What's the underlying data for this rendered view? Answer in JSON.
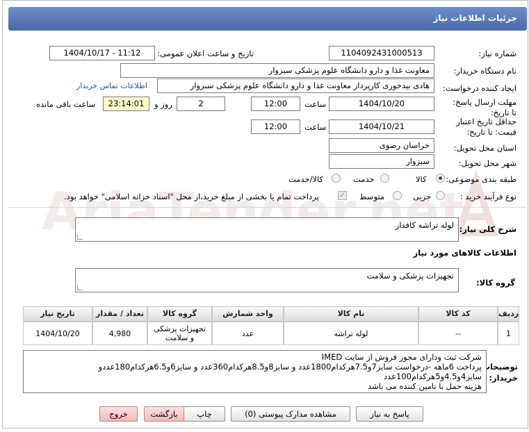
{
  "header": {
    "title": "جزئیات اطلاعات نیاز"
  },
  "form": {
    "need_number_label": "شماره نیاز:",
    "need_number": "1104092431000513",
    "announce_label": "تاریخ و ساعت اعلان عمومی:",
    "announce_value": "1404/10/17 - 11:12",
    "buyer_org_label": "نام دستگاه خریدار:",
    "buyer_org": "معاونت غذا و دارو   دانشگاه علوم پزشکی سبزوار",
    "creator_label": "ایجاد کننده درخواست:",
    "creator": "هادی بیدخوری کارپرداز معاونت غذا و دارو   دانشگاه علوم پزشکی سبزوار",
    "contact_link": "اطلاعات تماس خریدار",
    "deadline_label": "مهلت ارسال پاسخ: تا تاریخ:",
    "deadline_date": "1404/10/20",
    "time_label": "ساعت",
    "deadline_time": "12:00",
    "days_value": "2",
    "days_label": "روز و",
    "remaining_time": "23:14:01",
    "remaining_label": "ساعت باقی مانده",
    "validity_label_1": "حداقل تاریخ اعتبار",
    "validity_label_2": "قیمت: تا تاریخ:",
    "validity_date": "1404/10/21",
    "validity_time": "12:00",
    "province_label": "استان محل تحویل:",
    "province": "خراسان رضوی",
    "city_label": "شهر محل تحویل:",
    "city": "سبزوار",
    "category_label": "طبقه بندی موضوعی:",
    "category_options": [
      "کالا",
      "خدمت",
      "کالا/خدمت"
    ],
    "process_label": "نوع فرآیند خرید :",
    "process_options": [
      "جزیی",
      "متوسط"
    ],
    "payment_note": "پرداخت تمام یا بخشی از مبلغ خرید،از محل \"اسناد خزانه اسلامی\" خواهد بود.",
    "general_desc_label": "شرح کلی نیاز:",
    "general_desc": "لوله تراشه کافدار",
    "goods_info_title": "اطلاعات کالاهای مورد نیاز",
    "goods_group_label": "گروه کالا:",
    "goods_group": "تجهیزات پزشکی و سلامت",
    "buyer_notes_label_1": "توضیحات",
    "buyer_notes_label_2": "خریدار:",
    "buyer_notes": [
      "شرکت ثبت ودارای مجوز فروش از سایت IMED",
      "پرداخت 6ماهه -درخواست سایز7و7.5هرکدام1800عدد و سایز8و8.5هرکدام360عدد و سایز6و6.5هرکدام180عددو",
      "سایز4و4.5و5هرکدام100عدد",
      "هزینه حمل با تامین کننده می باشد"
    ]
  },
  "table": {
    "headers": [
      "ردیف",
      "کد کالا",
      "نام کالا",
      "واحد شمارش",
      "گروه کالا",
      "تعداد / مقدار",
      "تاریخ نیاز"
    ],
    "rows": [
      [
        "1",
        "--",
        "لوله تراشه",
        "عدد",
        "تجهیزات پزشکی و سلامت",
        "4,980",
        "1404/10/20"
      ]
    ]
  },
  "buttons": {
    "reply": "پاسخ به نیاز",
    "docs": "مشاهده مدارک پیوستی (0)",
    "print": "چاپ",
    "back": "بازگشت",
    "exit": "خروج"
  },
  "watermark": "AriaTender.net",
  "colors": {
    "title_bar": "#5a7bbd",
    "link": "#1a4fd6",
    "remaining_bg": "#ffffcc",
    "watermark": "#e6c9c9"
  }
}
